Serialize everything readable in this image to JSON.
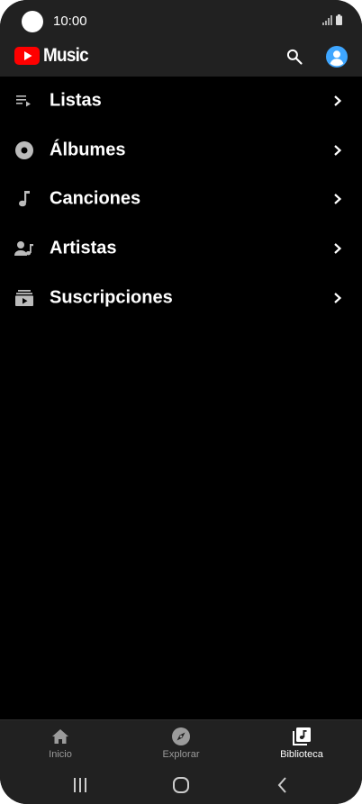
{
  "status_bar": {
    "time": "10:00"
  },
  "header": {
    "app_name": "Music",
    "search_icon": "search-icon",
    "account_icon": "account-icon"
  },
  "colors": {
    "brand_red": "#ff0000",
    "avatar_blue": "#3ea6ff",
    "background": "#000000",
    "bar": "#212121"
  },
  "library": {
    "items": [
      {
        "label": "Listas",
        "icon": "playlist-icon"
      },
      {
        "label": "Álbumes",
        "icon": "album-icon"
      },
      {
        "label": "Canciones",
        "icon": "music-note-icon"
      },
      {
        "label": "Artistas",
        "icon": "artist-icon"
      },
      {
        "label": "Suscripciones",
        "icon": "subscriptions-icon"
      }
    ]
  },
  "bottom_nav": {
    "items": [
      {
        "label": "Inicio",
        "icon": "home-icon",
        "active": false
      },
      {
        "label": "Explorar",
        "icon": "compass-icon",
        "active": false
      },
      {
        "label": "Biblioteca",
        "icon": "library-icon",
        "active": true
      }
    ]
  },
  "system_nav": {
    "recents_icon": "recents-icon",
    "home_icon": "home-circle-icon",
    "back_icon": "back-icon"
  }
}
